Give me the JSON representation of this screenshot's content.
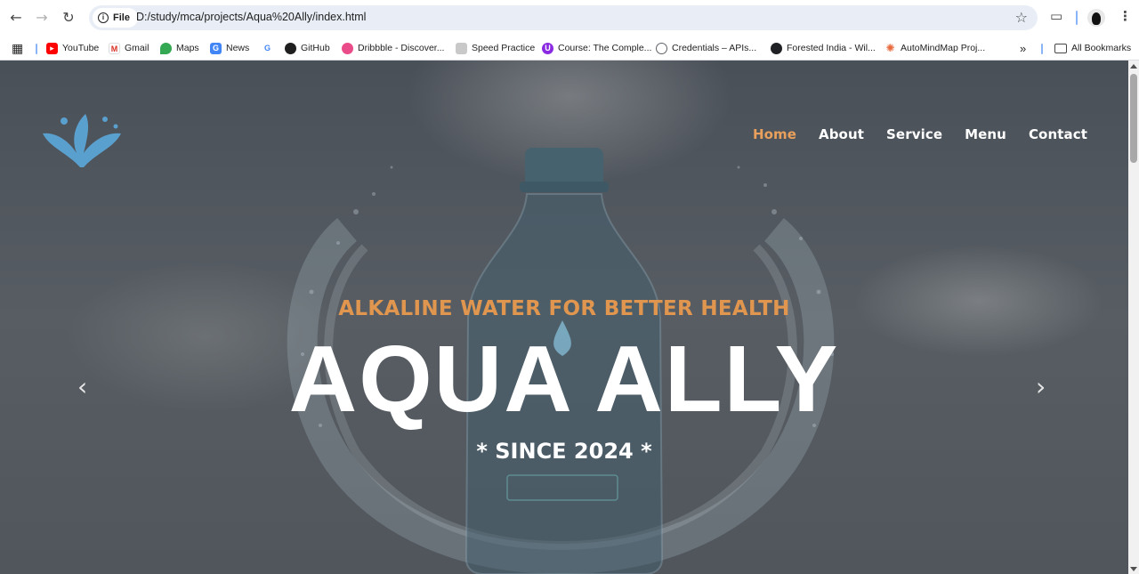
{
  "browser": {
    "site_chip": "File",
    "url": "D:/study/mca/projects/Aqua%20Ally/index.html",
    "bookmarks": [
      {
        "label": "YouTube",
        "icon": "youtube-icon"
      },
      {
        "label": "Gmail",
        "icon": "gmail-icon"
      },
      {
        "label": "Maps",
        "icon": "maps-icon"
      },
      {
        "label": "News",
        "icon": "news-icon"
      },
      {
        "label": "",
        "icon": "google-icon"
      },
      {
        "label": "GitHub",
        "icon": "github-icon"
      },
      {
        "label": "Dribbble - Discover...",
        "icon": "dribbble-icon"
      },
      {
        "label": "Speed Practice",
        "icon": "speed-practice-icon"
      },
      {
        "label": "Course: The Comple...",
        "icon": "course-icon"
      },
      {
        "label": "Credentials – APIs...",
        "icon": "credentials-icon"
      },
      {
        "label": "Forested India - Wil...",
        "icon": "globe-icon"
      },
      {
        "label": "AutoMindMap Proj...",
        "icon": "automindmap-icon"
      }
    ],
    "all_bookmarks": "All Bookmarks"
  },
  "site": {
    "menu": [
      {
        "label": "Home",
        "active": true
      },
      {
        "label": "About",
        "active": false
      },
      {
        "label": "Service",
        "active": false
      },
      {
        "label": "Menu",
        "active": false
      },
      {
        "label": "Contact",
        "active": false
      }
    ],
    "hero": {
      "tagline": "ALKALINE WATER FOR BETTER HEALTH",
      "title": "AQUA ALLY",
      "since": "* SINCE 2024 *"
    }
  },
  "colors": {
    "accent": "#e8a05c",
    "logo_blue": "#5aa0cf",
    "hero_overlay": "#50565c"
  }
}
